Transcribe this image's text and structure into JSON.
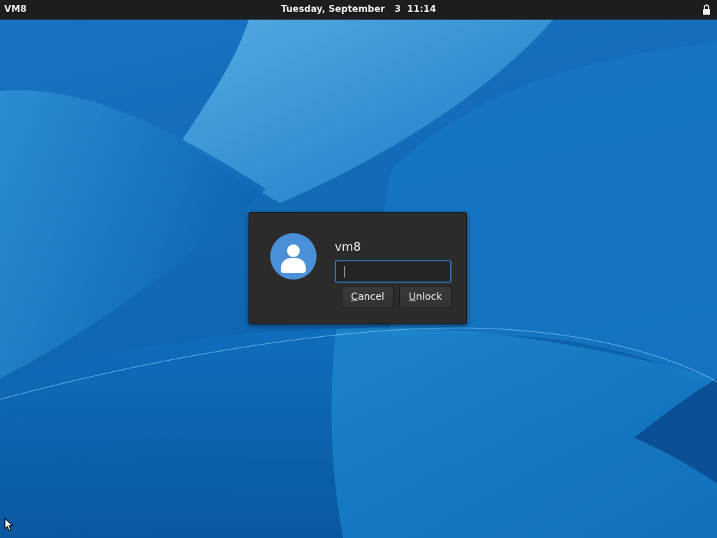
{
  "topbar": {
    "activities_label": "VM8",
    "clock_text": "Tuesday, September   3  11:14",
    "lock_icon": "lock-icon"
  },
  "dialog": {
    "avatar_icon": "user-avatar-icon",
    "username": "vm8",
    "password_value": "",
    "cancel_button": {
      "mnemonic": "C",
      "rest": "ancel"
    },
    "unlock_button": {
      "mnemonic": "U",
      "rest": "nlock"
    }
  },
  "colors": {
    "topbar_bg": "#1d1d1d",
    "dialog_bg": "#2b2b2b",
    "avatar_bg": "#4a90d9",
    "focus_border": "#3b7bc4",
    "wallpaper_base": "#0a63b2"
  }
}
